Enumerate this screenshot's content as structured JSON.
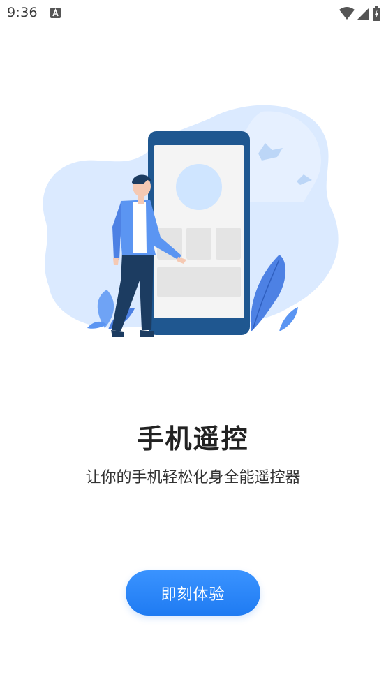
{
  "status_bar": {
    "time": "9:36",
    "icons": [
      "notification-a-icon",
      "wifi-icon",
      "cell-signal-icon",
      "battery-charging-icon"
    ]
  },
  "illustration": {
    "name": "person-with-phone-illustration",
    "colors": {
      "blob": "#d8e9ff",
      "phone_frame": "#1f5790",
      "screen": "#f4f4f4",
      "placeholder": "#e4e4e4",
      "avatar_circle": "#cfe5ff",
      "jacket": "#5b95f2",
      "pants": "#1c3c61",
      "plant": "#4d81e4"
    }
  },
  "onboarding": {
    "title": "手机遥控",
    "subtitle": "让你的手机轻松化身全能遥控器",
    "cta_label": "即刻体验"
  },
  "colors": {
    "accent": "#1f7bf2",
    "title_text": "#222222",
    "body_text": "#333333"
  }
}
